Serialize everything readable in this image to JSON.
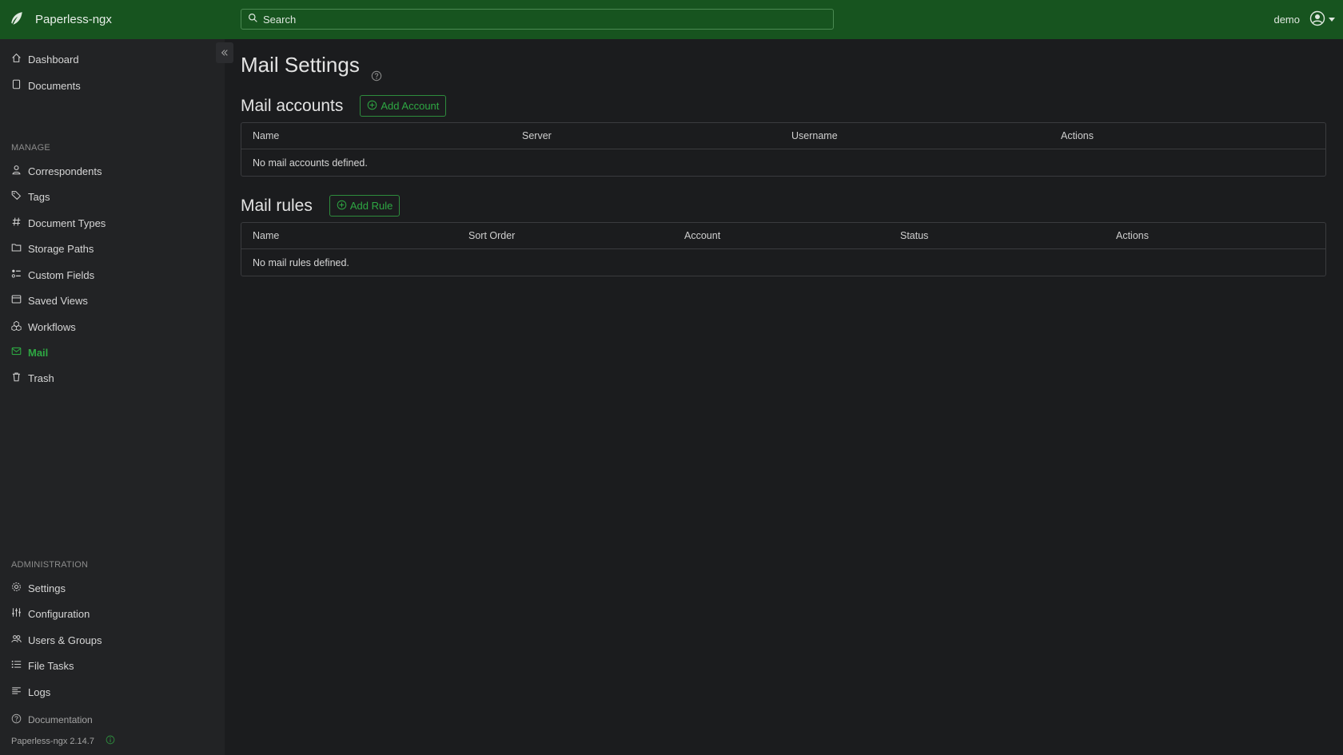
{
  "app": {
    "name": "Paperless-ngx",
    "version": "Paperless-ngx 2.14.7"
  },
  "search": {
    "placeholder": "Search"
  },
  "user": {
    "name": "demo"
  },
  "sidebar": {
    "top_items": [
      {
        "label": "Dashboard",
        "icon": "house-icon"
      },
      {
        "label": "Documents",
        "icon": "file-icon"
      }
    ],
    "manage_label": "MANAGE",
    "manage_items": [
      {
        "label": "Correspondents",
        "icon": "person-icon"
      },
      {
        "label": "Tags",
        "icon": "tags-icon"
      },
      {
        "label": "Document Types",
        "icon": "hash-icon"
      },
      {
        "label": "Storage Paths",
        "icon": "folder-icon"
      },
      {
        "label": "Custom Fields",
        "icon": "ui-radios-icon"
      },
      {
        "label": "Saved Views",
        "icon": "window-stack-icon"
      },
      {
        "label": "Workflows",
        "icon": "boxes-icon"
      },
      {
        "label": "Mail",
        "icon": "envelope-icon",
        "active": true
      },
      {
        "label": "Trash",
        "icon": "trash-icon"
      }
    ],
    "admin_label": "ADMINISTRATION",
    "admin_items": [
      {
        "label": "Settings",
        "icon": "gear-icon"
      },
      {
        "label": "Configuration",
        "icon": "sliders-icon"
      },
      {
        "label": "Users & Groups",
        "icon": "people-icon"
      },
      {
        "label": "File Tasks",
        "icon": "list-task-icon"
      },
      {
        "label": "Logs",
        "icon": "text-left-icon"
      }
    ],
    "documentation": "Documentation"
  },
  "main": {
    "title": "Mail Settings",
    "accounts": {
      "title": "Mail accounts",
      "add_label": "Add Account",
      "columns": [
        "Name",
        "Server",
        "Username",
        "Actions"
      ],
      "empty": "No mail accounts defined."
    },
    "rules": {
      "title": "Mail rules",
      "add_label": "Add Rule",
      "columns": [
        "Name",
        "Sort Order",
        "Account",
        "Status",
        "Actions"
      ],
      "empty": "No mail rules defined."
    }
  },
  "colors": {
    "topbar": "#17541f",
    "accent": "#2ea843",
    "background": "#1b1c1e",
    "sidebar": "#222325"
  }
}
